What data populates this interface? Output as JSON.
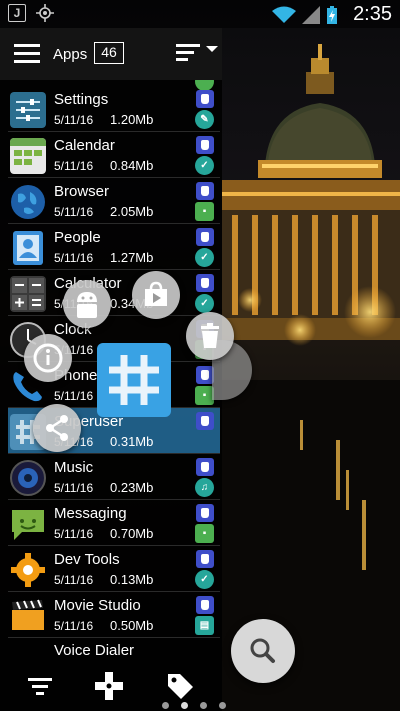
{
  "status_bar": {
    "time": "2:35",
    "left_icons": [
      "j-notification-icon",
      "gps-icon"
    ],
    "right_icons": [
      "wifi-icon",
      "signal-icon",
      "battery-charging-icon"
    ]
  },
  "header": {
    "title": "Apps",
    "count": "46"
  },
  "apps": [
    {
      "name": "Settings",
      "date": "5/11/16",
      "size": "1.20Mb",
      "category_icon": "wrench-icon",
      "category_color": "#26a69a"
    },
    {
      "name": "Calendar",
      "date": "5/11/16",
      "size": "0.84Mb",
      "category_icon": "check-icon",
      "category_color": "#26a69a"
    },
    {
      "name": "Browser",
      "date": "5/11/16",
      "size": "2.05Mb",
      "category_icon": "chat-icon",
      "category_color": "#4caf50"
    },
    {
      "name": "People",
      "date": "5/11/16",
      "size": "1.27Mb",
      "category_icon": "check-icon",
      "category_color": "#26a69a"
    },
    {
      "name": "Calculator",
      "date": "5/11/16",
      "size": "0.34Mb",
      "category_icon": "check-icon",
      "category_color": "#26a69a"
    },
    {
      "name": "Clock",
      "date": "5/11/16",
      "size": "",
      "category_icon": "chat-icon",
      "category_color": "#4caf50"
    },
    {
      "name": "Phone",
      "date": "5/11/16",
      "size": "",
      "category_icon": "chat-icon",
      "category_color": "#4caf50"
    },
    {
      "name": "Superuser",
      "date": "5/11/16",
      "size": "0.31Mb",
      "category_icon": "",
      "category_color": ""
    },
    {
      "name": "Music",
      "date": "5/11/16",
      "size": "0.23Mb",
      "category_icon": "music-icon",
      "category_color": "#26a69a"
    },
    {
      "name": "Messaging",
      "date": "5/11/16",
      "size": "0.70Mb",
      "category_icon": "chat-icon",
      "category_color": "#4caf50"
    },
    {
      "name": "Dev Tools",
      "date": "5/11/16",
      "size": "0.13Mb",
      "category_icon": "check-icon",
      "category_color": "#26a69a"
    },
    {
      "name": "Movie Studio",
      "date": "5/11/16",
      "size": "0.50Mb",
      "category_icon": "film-icon",
      "category_color": "#26a69a"
    },
    {
      "name": "Voice Dialer",
      "date": "",
      "size": "",
      "category_icon": "",
      "category_color": ""
    }
  ],
  "radial_menu": {
    "actions": [
      "android-icon",
      "play-store-icon",
      "trash-icon",
      "info-icon",
      "share-icon"
    ],
    "center_app_icon": "superuser-hash-icon"
  },
  "bottom_bar": {
    "icons": [
      "filter-icon",
      "gamepad-icon",
      "tag-icon"
    ]
  },
  "page_indicator": {
    "pages": 4,
    "current": 1
  },
  "colors": {
    "selected_row": "#339bdd",
    "store_badge": "#3f4ec9",
    "superuser_blue": "#39a2e4"
  }
}
